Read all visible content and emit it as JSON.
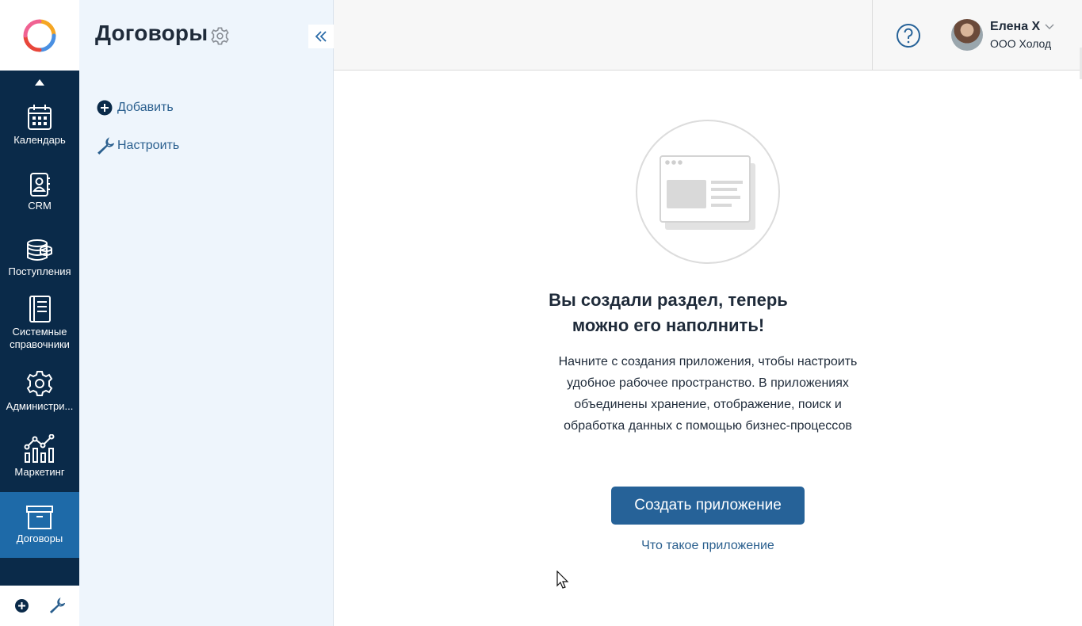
{
  "rail": {
    "items": [
      {
        "label": "Календарь",
        "icon": "calendar-icon"
      },
      {
        "label": "CRM",
        "icon": "contact-book-icon"
      },
      {
        "label": "Поступления",
        "icon": "coins-stack-icon"
      },
      {
        "label": "Системные справочники",
        "icon": "book-icon"
      },
      {
        "label": "Администри...",
        "icon": "gear-icon"
      },
      {
        "label": "Маркетинг",
        "icon": "chart-icon"
      },
      {
        "label": "Договоры",
        "icon": "archive-box-icon",
        "active": true
      }
    ],
    "active_color": "#1e6aa8",
    "background_color": "#0a2a49"
  },
  "sidebar": {
    "title": "Договоры",
    "links": [
      {
        "label": "Добавить",
        "icon": "plus-circle-icon"
      },
      {
        "label": "Настроить",
        "icon": "wrench-icon"
      }
    ]
  },
  "header": {
    "user_name": "Елена Х",
    "user_org": "ООО Холод"
  },
  "empty_state": {
    "title": "Вы создали раздел, теперь можно его наполнить!",
    "text": "Начните с создания приложения, чтобы настроить удобное рабочее пространство. В приложениях объединены хранение, отображение, поиск и обработка данных с помощью бизнес-процессов",
    "button_label": "Создать приложение",
    "link_label": "Что такое приложение"
  },
  "colors": {
    "accent": "#266298",
    "link": "#2a5f8e",
    "sidebar_bg": "#eef5fc"
  }
}
